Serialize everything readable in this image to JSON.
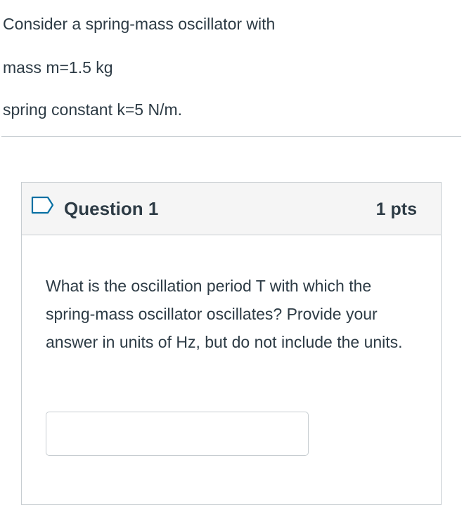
{
  "intro": {
    "line1": "Consider a spring-mass oscillator with",
    "line2": "mass m=1.5 kg",
    "line3": "spring constant k=5 N/m."
  },
  "question": {
    "flag_icon": "bookmark-flag-icon",
    "title": "Question 1",
    "points": "1 pts",
    "text": "What is the oscillation period T with which the spring-mass oscillator oscillates? Provide your answer in units of Hz, but do not include the units.",
    "answer_value": ""
  },
  "colors": {
    "text": "#2d3b45",
    "border": "#c7cdd1",
    "header_bg": "#f5f5f5",
    "flag": "#0770a3"
  }
}
